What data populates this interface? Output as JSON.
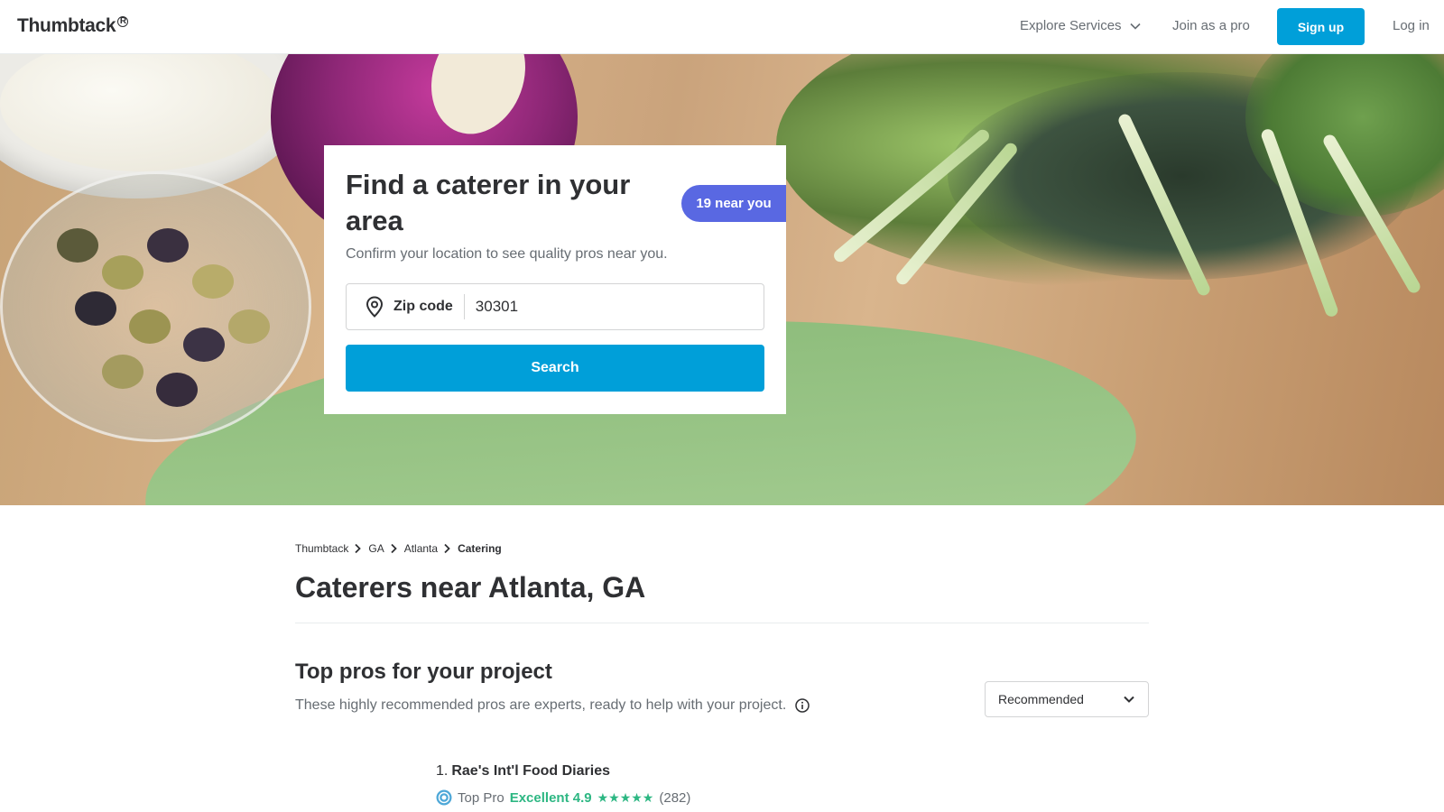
{
  "header": {
    "logo": "Thumbtack",
    "logo_mark": "R",
    "explore": "Explore Services",
    "join": "Join as a pro",
    "signup": "Sign up",
    "login": "Log in"
  },
  "hero": {
    "title": "Find a caterer in your area",
    "badge": "19 near you",
    "subtitle": "Confirm your location to see quality pros near you.",
    "zip_label": "Zip code",
    "zip_value": "30301",
    "search_label": "Search"
  },
  "breadcrumb": [
    "Thumbtack",
    "GA",
    "Atlanta",
    "Catering"
  ],
  "page_title": "Caterers near Atlanta, GA",
  "section": {
    "title": "Top pros for your project",
    "subtitle": "These highly recommended pros are experts, ready to help with your project.",
    "sort_value": "Recommended"
  },
  "pros": [
    {
      "rank": "1.",
      "name": "Rae's Int'l Food Diaries",
      "badge": "Top Pro",
      "rating_label": "Excellent 4.9",
      "stars": "★★★★★",
      "reviews": "(282)"
    }
  ],
  "colors": {
    "brand_blue": "#009fd9",
    "badge_purple": "#5968e2",
    "rating_green": "#2db783"
  },
  "icons": {
    "explore": "chevron-down-icon",
    "zip": "location-pin-icon",
    "breadcrumb_sep": "chevron-right-icon",
    "info": "info-icon",
    "sort": "chevron-down-icon",
    "top_pro": "top-pro-badge-icon"
  }
}
